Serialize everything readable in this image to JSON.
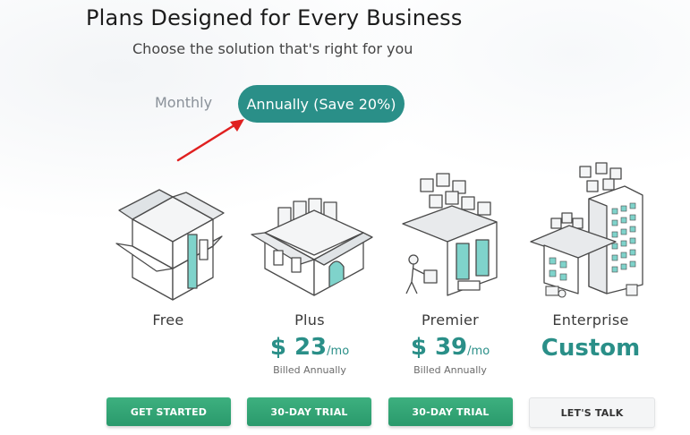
{
  "header": {
    "title": "Plans Designed for Every Business",
    "subtitle": "Choose the solution that's right for you"
  },
  "billing_toggle": {
    "monthly_label": "Monthly",
    "annually_label": "Annually (Save 20%)",
    "selected": "annually"
  },
  "annotation": {
    "arrow_color": "#e02020"
  },
  "plans": [
    {
      "name": "Free",
      "button_label": "GET STARTED"
    },
    {
      "name": "Plus",
      "price": "$ 23",
      "period": "/mo",
      "billing_note": "Billed Annually",
      "button_label": "30-DAY TRIAL"
    },
    {
      "name": "Premier",
      "price": "$ 39",
      "period": "/mo",
      "billing_note": "Billed Annually",
      "button_label": "30-DAY TRIAL"
    },
    {
      "name": "Enterprise",
      "price_text": "Custom",
      "button_label": "LET'S TALK"
    }
  ],
  "colors": {
    "accent": "#2a8f88",
    "button_green": "#35a575"
  }
}
